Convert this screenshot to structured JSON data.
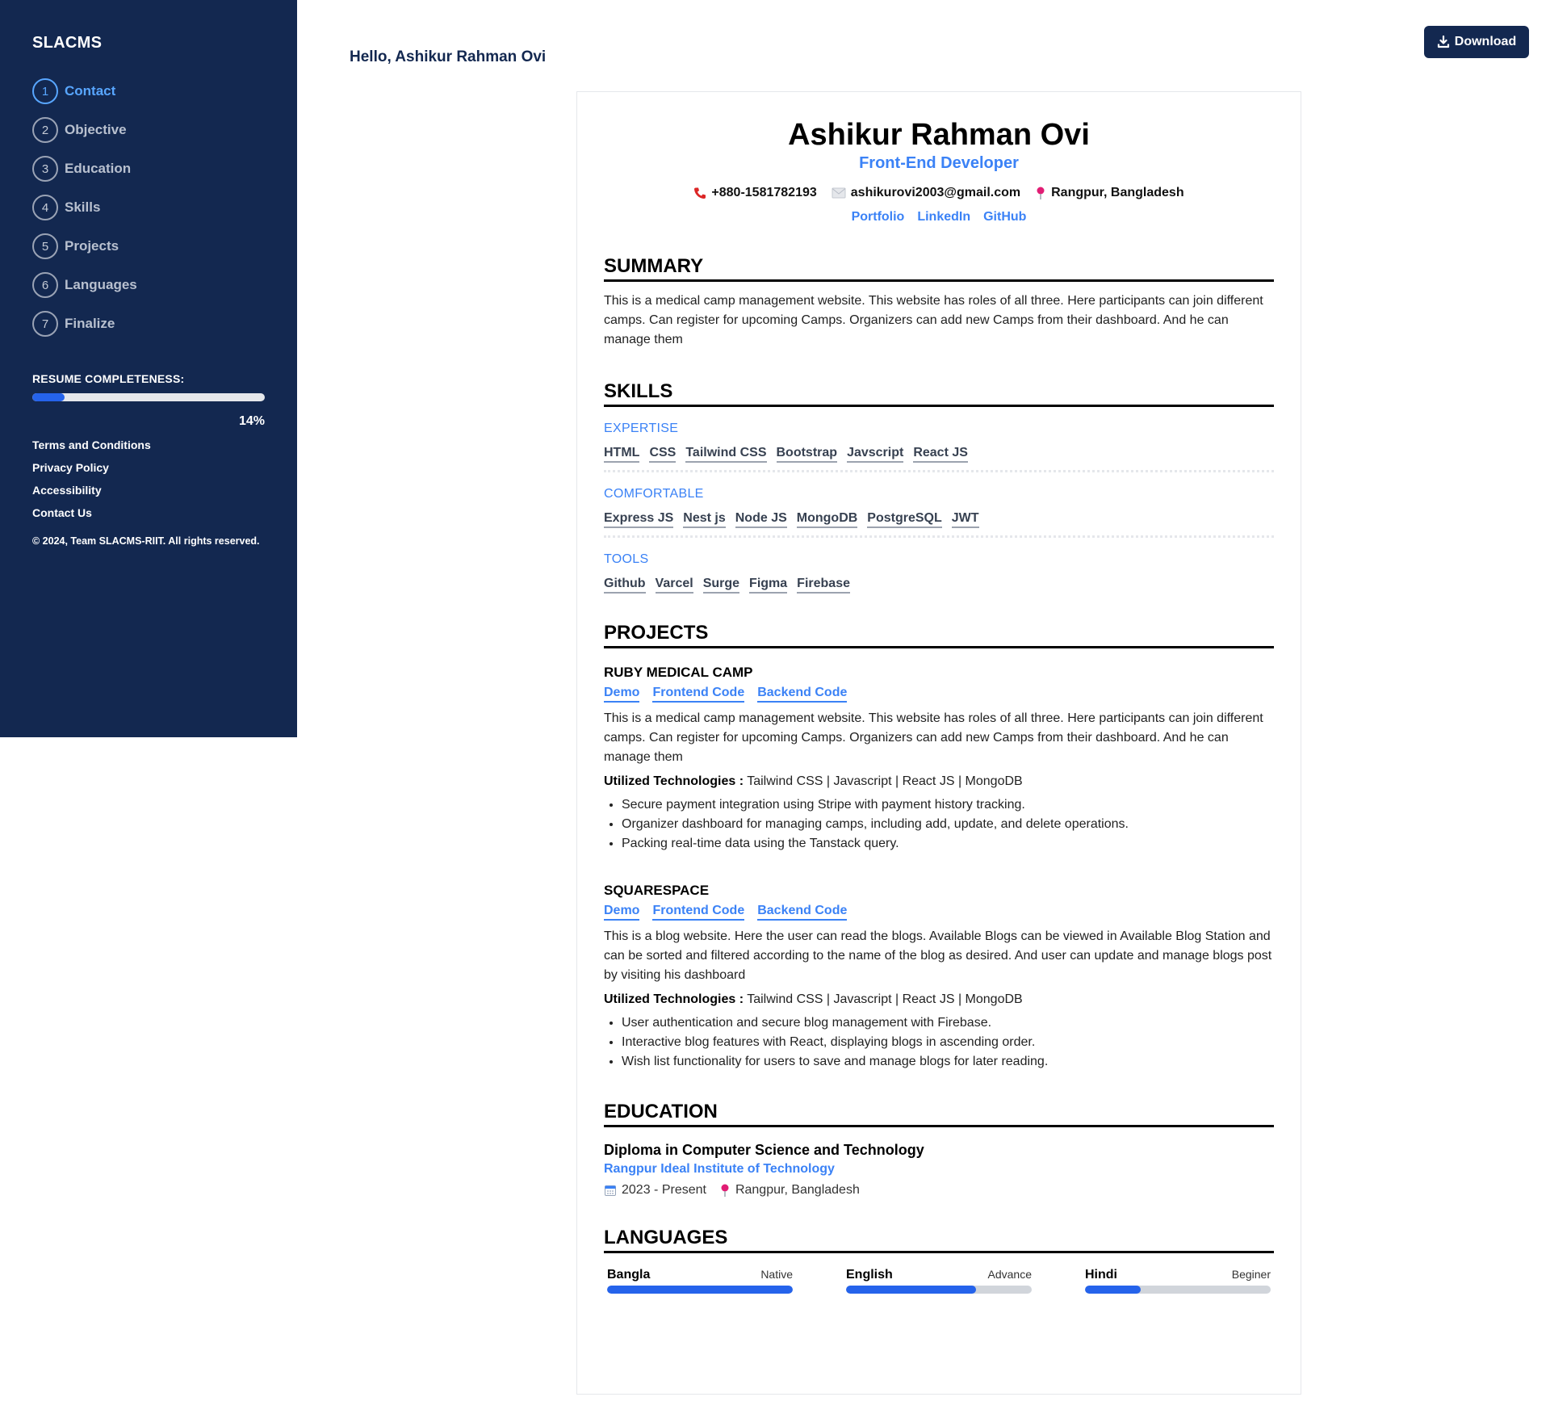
{
  "sidebar": {
    "brand": "SLACMS",
    "steps": [
      {
        "num": "1",
        "label": "Contact"
      },
      {
        "num": "2",
        "label": "Objective"
      },
      {
        "num": "3",
        "label": "Education"
      },
      {
        "num": "4",
        "label": "Skills"
      },
      {
        "num": "5",
        "label": "Projects"
      },
      {
        "num": "6",
        "label": "Languages"
      },
      {
        "num": "7",
        "label": "Finalize"
      }
    ],
    "completeness_label": "RESUME COMPLETENESS:",
    "completeness_value": 0.14,
    "completeness_text": "14%",
    "footer_links": [
      "Terms and Conditions",
      "Privacy Policy",
      "Accessibility",
      "Contact Us"
    ],
    "copyright": "© 2024, Team SLACMS-RIIT. All rights reserved."
  },
  "header": {
    "greeting": "Hello, Ashikur Rahman Ovi",
    "download_label": "Download"
  },
  "resume": {
    "name": "Ashikur Rahman Ovi",
    "role": "Front-End Developer",
    "phone": "+880-1581782193",
    "email": "ashikurovi2003@gmail.com",
    "location": "Rangpur, Bangladesh",
    "links": [
      "Portfolio",
      "LinkedIn",
      "GitHub"
    ],
    "summary_title": "SUMMARY",
    "summary": "This is a medical camp management website. This website has roles of all three. Here participants can join different camps. Can register for upcoming Camps. Organizers can add new Camps from their dashboard. And he can manage them",
    "skills_title": "SKILLS",
    "skills": {
      "expertise_label": "EXPERTISE",
      "expertise": [
        "HTML",
        "CSS",
        "Tailwind CSS",
        "Bootstrap",
        "Javscript",
        "React JS"
      ],
      "comfortable_label": "COMFORTABLE",
      "comfortable": [
        "Express JS",
        "Nest js",
        "Node JS",
        "MongoDB",
        "PostgreSQL",
        "JWT"
      ],
      "tools_label": "TOOLS",
      "tools": [
        "Github",
        "Varcel",
        "Surge",
        "Figma",
        "Firebase"
      ]
    },
    "projects_title": "PROJECTS",
    "projects": [
      {
        "title": "RUBY MEDICAL CAMP",
        "links": [
          "Demo",
          "Frontend Code",
          "Backend Code"
        ],
        "description": "This is a medical camp management website. This website has roles of all three. Here participants can join different camps. Can register for upcoming Camps. Organizers can add new Camps from their dashboard. And he can manage them",
        "tech_label": "Utilized Technologies :",
        "tech": "Tailwind CSS |  Javascript |  React JS |  MongoDB",
        "bullets": [
          "Secure payment integration using Stripe with payment history tracking.",
          "Organizer dashboard for managing camps, including add, update, and delete operations.",
          "Packing real-time data using the Tanstack query."
        ]
      },
      {
        "title": "SQUARESPACE",
        "links": [
          "Demo",
          "Frontend Code",
          "Backend Code"
        ],
        "description": "This is a blog website. Here the user can read the blogs. Available Blogs can be viewed in Available Blog Station and can be sorted and filtered according to the name of the blog as desired. And user can update and manage blogs post by visiting his dashboard",
        "tech_label": "Utilized Technologies :",
        "tech": "Tailwind CSS |  Javascript |  React JS |  MongoDB",
        "bullets": [
          "User authentication and secure blog management with Firebase.",
          "Interactive blog features with React, displaying blogs in ascending order.",
          "Wish list functionality for users to save and manage blogs for later reading."
        ]
      }
    ],
    "education_title": "EDUCATION",
    "education": {
      "degree": "Diploma in Computer Science and Technology",
      "institution": "Rangpur Ideal Institute of Technology",
      "period": "2023 - Present",
      "location": "Rangpur, Bangladesh"
    },
    "languages_title": "LANGUAGES",
    "languages": [
      {
        "name": "Bangla",
        "level": "Native",
        "value": 1.0
      },
      {
        "name": "English",
        "level": "Advance",
        "value": 0.7
      },
      {
        "name": "Hindi",
        "level": "Beginer",
        "value": 0.3
      }
    ]
  },
  "colors": {
    "sidebar_bg": "#132850",
    "accent": "#3b82f6",
    "progress": "#2563eb"
  },
  "icons": [
    "phone-icon",
    "mail-icon",
    "pin-icon",
    "calendar-icon",
    "download-icon"
  ]
}
